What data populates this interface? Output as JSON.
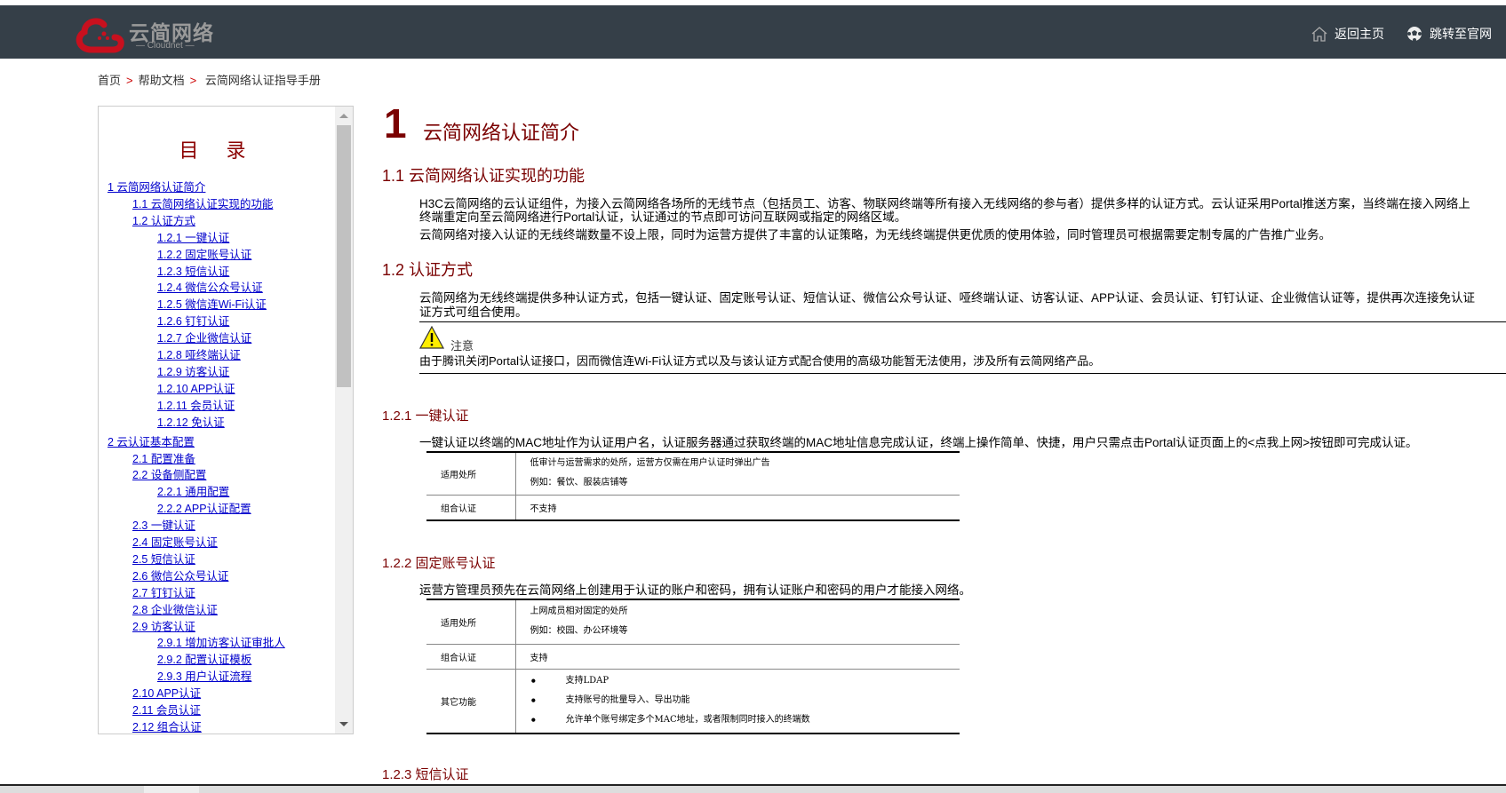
{
  "header": {
    "logo_cn": "云简网络",
    "logo_en": "— Cloudnet —",
    "nav_home": "返回主页",
    "nav_official": "跳转至官网"
  },
  "breadcrumb": [
    "首页",
    "帮助文档",
    "云简网络认证指导手册"
  ],
  "toc": {
    "title": "目 录",
    "items": [
      {
        "level": 1,
        "label": "1 云简网络认证简介"
      },
      {
        "level": 2,
        "label": "1.1 云简网络认证实现的功能"
      },
      {
        "level": 2,
        "label": "1.2 认证方式"
      },
      {
        "level": 3,
        "label": "1.2.1 一键认证"
      },
      {
        "level": 3,
        "label": "1.2.2 固定账号认证"
      },
      {
        "level": 3,
        "label": "1.2.3 短信认证"
      },
      {
        "level": 3,
        "label": "1.2.4 微信公众号认证"
      },
      {
        "level": 3,
        "label": "1.2.5 微信连Wi-Fi认证"
      },
      {
        "level": 3,
        "label": "1.2.6 钉钉认证"
      },
      {
        "level": 3,
        "label": "1.2.7 企业微信认证"
      },
      {
        "level": 3,
        "label": "1.2.8 哑终端认证"
      },
      {
        "level": 3,
        "label": "1.2.9 访客认证"
      },
      {
        "level": 3,
        "label": "1.2.10 APP认证"
      },
      {
        "level": 3,
        "label": "1.2.11 会员认证"
      },
      {
        "level": 3,
        "label": "1.2.12 免认证"
      },
      {
        "level": 1,
        "label": "2 云认证基本配置"
      },
      {
        "level": 2,
        "label": "2.1 配置准备"
      },
      {
        "level": 2,
        "label": "2.2 设备侧配置"
      },
      {
        "level": 3,
        "label": "2.2.1 通用配置"
      },
      {
        "level": 3,
        "label": "2.2.2 APP认证配置"
      },
      {
        "level": 2,
        "label": "2.3 一键认证"
      },
      {
        "level": 2,
        "label": "2.4 固定账号认证"
      },
      {
        "level": 2,
        "label": "2.5 短信认证"
      },
      {
        "level": 2,
        "label": "2.6 微信公众号认证"
      },
      {
        "level": 2,
        "label": "2.7 钉钉认证"
      },
      {
        "level": 2,
        "label": "2.8 企业微信认证"
      },
      {
        "level": 2,
        "label": "2.9 访客认证"
      },
      {
        "level": 3,
        "label": "2.9.1 增加访客认证审批人"
      },
      {
        "level": 3,
        "label": "2.9.2 配置认证模板"
      },
      {
        "level": 3,
        "label": "2.9.3 用户认证流程"
      },
      {
        "level": 2,
        "label": "2.10 APP认证"
      },
      {
        "level": 2,
        "label": "2.11 会员认证"
      },
      {
        "level": 2,
        "label": "2.12 组合认证"
      }
    ]
  },
  "doc": {
    "ch_num": "1",
    "ch_title": "云简网络认证简介",
    "s11": "1.1  云简网络认证实现的功能",
    "s11_p1a": "H3C云简网络的云认证组件，为接入云简网络各场所的无线节点（包括员工、访客、物联网终端等所有接入无线网络的参与者）提供多样的认证方式。云认证采用Portal推送方案，当终端在接入网络上",
    "s11_p1b": "终端重定向至云简网络进行Portal认证，认证通过的节点即可访问互联网或指定的网络区域。",
    "s11_p2": "云简网络对接入认证的无线终端数量不设上限，同时为运营方提供了丰富的认证策略，为无线终端提供更优质的使用体验，同时管理员可根据需要定制专属的广告推广业务。",
    "s12": "1.2  认证方式",
    "s12_pa": "云简网络为无线终端提供多种认证方式，包括一键认证、固定账号认证、短信认证、微信公众号认证、哑终端认证、访客认证、APP认证、会员认证、钉钉认证、企业微信认证等，提供再次连接免认证",
    "s12_pb": "证方式可组合使用。",
    "note_label": "注意",
    "note_text": "由于腾讯关闭Portal认证接口，因而微信连Wi-Fi认证方式以及与该认证方式配合使用的高级功能暂无法使用，涉及所有云简网络产品。",
    "s121": "1.2.1  一键认证",
    "s121_p": "一键认证以终端的MAC地址作为认证用户名，认证服务器通过获取终端的MAC地址信息完成认证，终端上操作简单、快捷，用户只需点击Portal认证页面上的<点我上网>按钮即可完成认证。",
    "t1": {
      "k1": "适用处所",
      "v1a": "低审计与运营需求的处所，运营方仅需在用户认证时弹出广告",
      "v1b": "例如：餐饮、服装店铺等",
      "k2": "组合认证",
      "v2": "不支持"
    },
    "s122": "1.2.2  固定账号认证",
    "s122_p": "运营方管理员预先在云简网络上创建用于认证的账户和密码，拥有认证账户和密码的用户才能接入网络。",
    "t2": {
      "k1": "适用处所",
      "v1a": "上网成员相对固定的处所",
      "v1b": "例如：校园、办公环境等",
      "k2": "组合认证",
      "v2": "支持",
      "k3": "其它功能",
      "b1": "支持LDAP",
      "b2": "支持账号的批量导入、导出功能",
      "b3": "允许单个账号绑定多个MAC地址，或者限制同时接入的终端数"
    },
    "s123": "1.2.3  短信认证"
  }
}
